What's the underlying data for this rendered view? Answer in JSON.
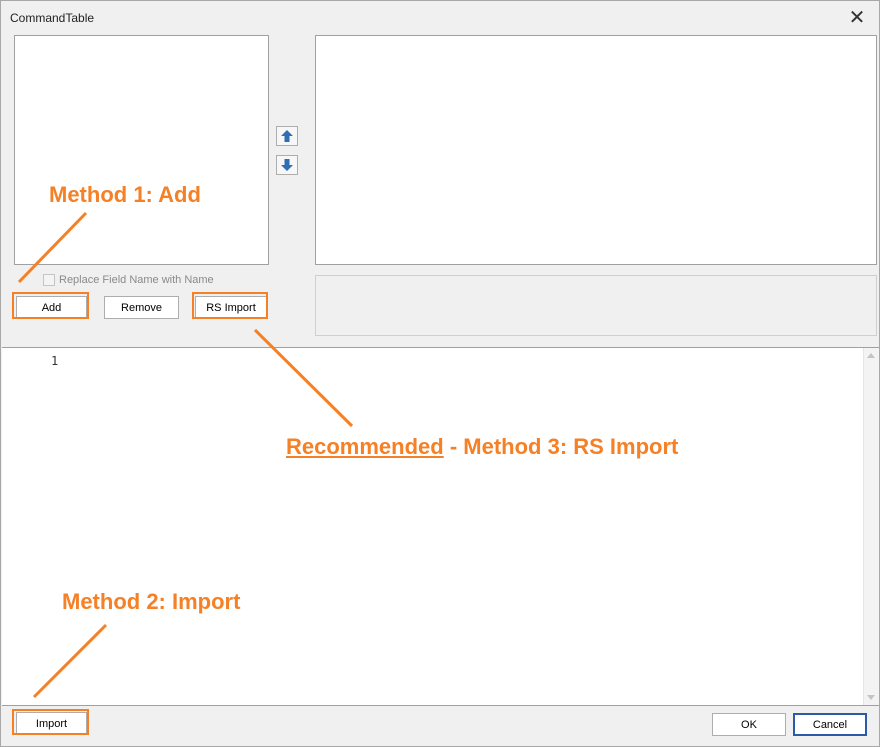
{
  "window": {
    "title": "CommandTable",
    "close_glyph": "✕"
  },
  "options": {
    "replace_field_label": "Replace Field Name with Name",
    "replace_field_checked": false
  },
  "left_buttons": {
    "add": "Add",
    "remove": "Remove",
    "rs_import": "RS Import"
  },
  "editor": {
    "line_numbers": [
      "1"
    ]
  },
  "footer": {
    "import": "Import",
    "ok": "OK",
    "cancel": "Cancel"
  },
  "annotations": {
    "method1": "Method 1: Add",
    "method2": "Method 2: Import",
    "method3_prefix": "Recommended",
    "method3_suffix": " - Method 3: RS Import",
    "color": "#f58025"
  },
  "icons": {
    "move_up": "arrow-up-icon",
    "move_down": "arrow-down-icon",
    "accent": "#2f6db5"
  }
}
